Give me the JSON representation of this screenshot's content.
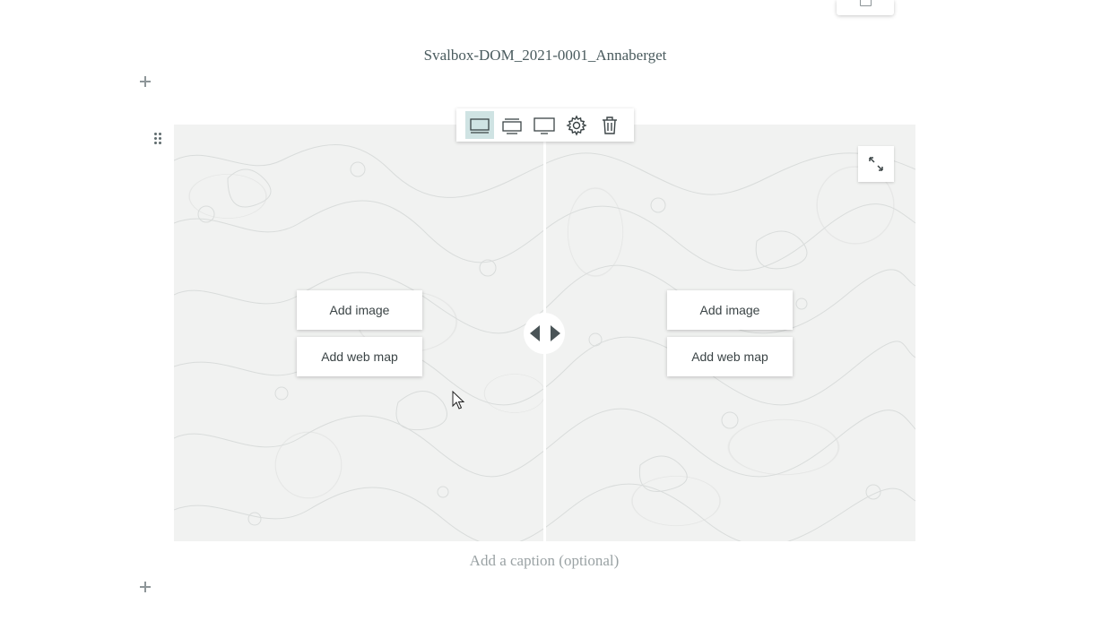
{
  "story": {
    "heading": "Svalbox-DOM_2021-0001_Annaberget"
  },
  "swipe": {
    "left_panel": {
      "add_image_label": "Add image",
      "add_web_map_label": "Add web map"
    },
    "right_panel": {
      "add_image_label": "Add image",
      "add_web_map_label": "Add web map"
    },
    "caption_placeholder": "Add a caption (optional)"
  },
  "toolbar": {
    "buttons": [
      {
        "icon": "layout-float-icon",
        "active": true
      },
      {
        "icon": "layout-standard-icon",
        "active": false
      },
      {
        "icon": "layout-wide-icon",
        "active": false
      },
      {
        "icon": "gear-icon",
        "active": false
      },
      {
        "icon": "trash-icon",
        "active": false
      }
    ],
    "active_color": "#cfe3e3"
  },
  "colors": {
    "heading": "#4a5b5e",
    "caption_placeholder": "#9aa2a4",
    "map_background": "#f1f2f1"
  }
}
